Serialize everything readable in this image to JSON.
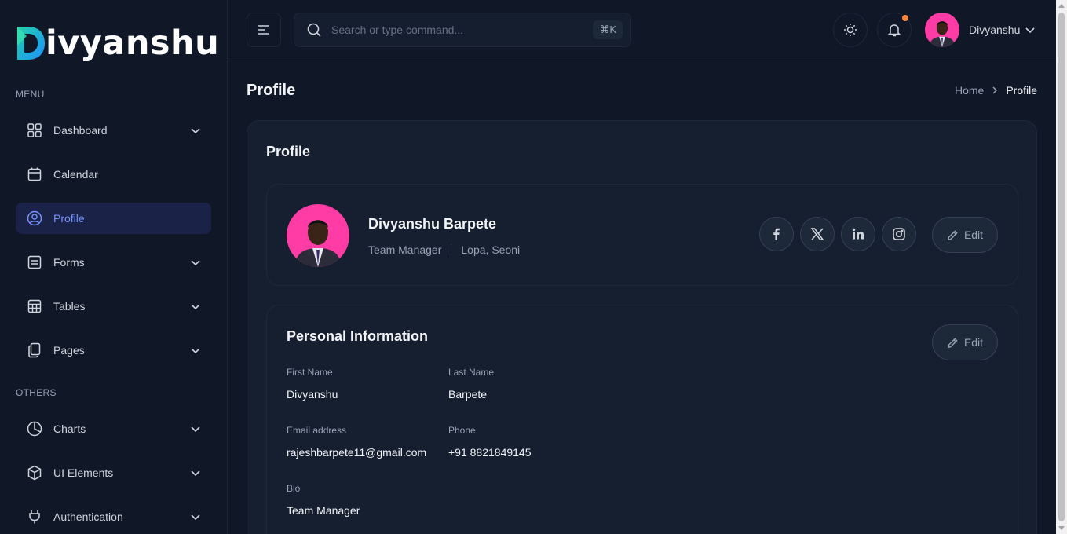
{
  "brand": {
    "name": "ivyanshu"
  },
  "sidebar": {
    "menu_label": "MENU",
    "others_label": "OTHERS",
    "items": [
      {
        "label": "Dashboard",
        "icon": "grid-icon",
        "has_chevron": true
      },
      {
        "label": "Calendar",
        "icon": "calendar-icon",
        "has_chevron": false
      },
      {
        "label": "Profile",
        "icon": "user-circle-icon",
        "has_chevron": false,
        "active": true
      },
      {
        "label": "Forms",
        "icon": "list-form-icon",
        "has_chevron": true
      },
      {
        "label": "Tables",
        "icon": "table-icon",
        "has_chevron": true
      },
      {
        "label": "Pages",
        "icon": "pages-icon",
        "has_chevron": true
      }
    ],
    "other_items": [
      {
        "label": "Charts",
        "icon": "pie-chart-icon",
        "has_chevron": true
      },
      {
        "label": "UI Elements",
        "icon": "box-icon",
        "has_chevron": true
      },
      {
        "label": "Authentication",
        "icon": "plug-icon",
        "has_chevron": true
      }
    ]
  },
  "header": {
    "search_placeholder": "Search or type command...",
    "shortcut": "⌘K",
    "user_name": "Divyanshu"
  },
  "page": {
    "title": "Profile",
    "breadcrumb": {
      "home": "Home",
      "current": "Profile"
    },
    "card_title": "Profile"
  },
  "profile": {
    "full_name": "Divyanshu Barpete",
    "role": "Team Manager",
    "location": "Lopa, Seoni",
    "edit_label": "Edit"
  },
  "personal_info": {
    "title": "Personal Information",
    "edit_label": "Edit",
    "first_name_label": "First Name",
    "first_name": "Divyanshu",
    "last_name_label": "Last Name",
    "last_name": "Barpete",
    "email_label": "Email address",
    "email": "rajeshbarpete11@gmail.com",
    "phone_label": "Phone",
    "phone": "+91 8821849145",
    "bio_label": "Bio",
    "bio": "Team Manager"
  },
  "colors": {
    "background": "#101828",
    "card": "#161f30",
    "accent": "#7592ff",
    "active_bg": "#1a2248",
    "notification": "#fd853a",
    "avatar_bg": "#ff3ca6"
  }
}
